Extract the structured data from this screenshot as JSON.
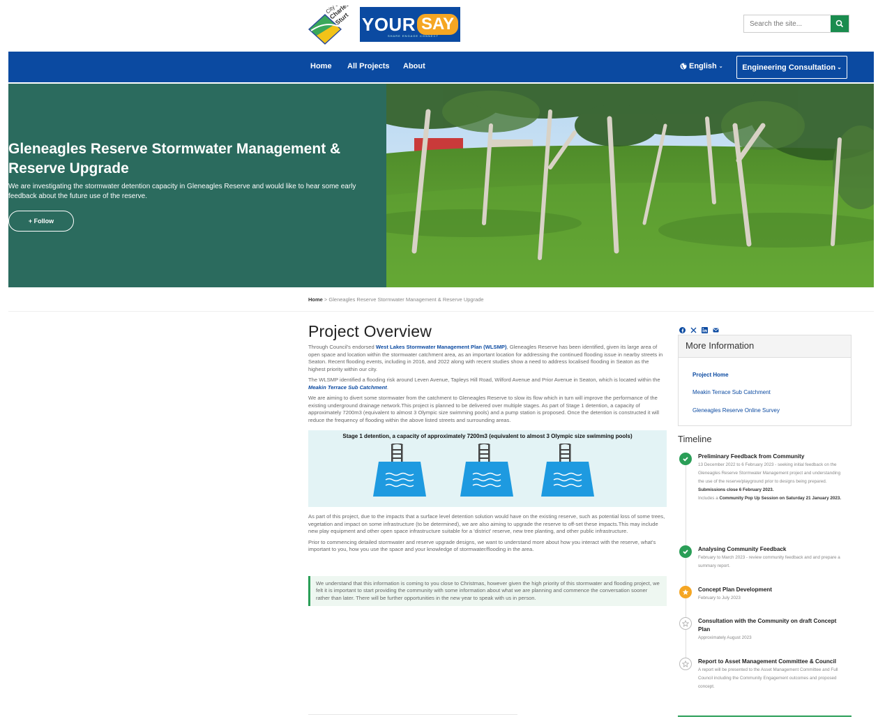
{
  "brand": {
    "city_logo_text": "City of Charles Sturt",
    "yoursay_your": "YOUR",
    "yoursay_say": "SAY",
    "yoursay_sub": "SHARE ENGAGE CONNECT"
  },
  "search": {
    "placeholder": "Search the site..."
  },
  "nav": {
    "items": [
      "Home",
      "All Projects",
      "About"
    ],
    "language": "English",
    "consultation": "Engineering Consultation"
  },
  "hero": {
    "title": "Gleneagles Reserve Stormwater Management & Reserve Upgrade",
    "description": "We are investigating the stormwater detention capacity in Gleneagles Reserve and would like to hear some early feedback about the future use of the reserve.",
    "follow_label": "+ Follow"
  },
  "breadcrumb": {
    "home": "Home",
    "sep": " > ",
    "current": "Gleneagles Reserve Stormwater Management & Reserve Upgrade"
  },
  "main": {
    "heading": "Project Overview",
    "p1_a": "Through Council's endorsed ",
    "p1_link": "West Lakes Stormwater Management Plan (WLSMP)",
    "p1_b": ", Gleneagles Reserve has been identified, given its large area of open space and location within the stormwater catchment area, as an important location for addressing the continued flooding issue in nearby streets in Seaton. Recent flooding events, including in 2016, and 2022 along with recent studies show a need to address localised flooding in Seaton as the highest priority within our city.",
    "p2_a": "The WLSMP identified a flooding risk around Leven Avenue, Tapleys Hill Road, Wilford Avenue and Prior Avenue in Seaton, which is located within the ",
    "p2_link": "Meakin Terrace Sub Catchment",
    "p2_b": ".",
    "p3": "We are aiming to divert some stormwater from the catchment to Gleneagles Reserve to slow its flow which in turn will improve the performance of the existing underground drainage network.This project is planned to be delivered over multiple stages. As part of Stage 1 detention, a capacity of approximately 7200m3 (equivalent to almost 3 Olympic size swimming pools) and a pump station is proposed. Once the detention is constructed it will reduce the frequency of flooding within the above listed streets and surrounding areas.",
    "stage_title": "Stage 1 detention, a capacity of approximately 7200m3 (equivalent to almost 3 Olympic size swimming pools)",
    "p4": "As part of this project, due to the impacts that a surface level detention solution would have on the existing reserve, such as potential loss of some trees, vegetation and impact on some infrastructure (to be determined), we are also aiming to upgrade the reserve to off-set these impacts.This may include new play equipment and other open space infrastructure suitable for a 'district' reserve, new tree planting, and other public infrastructure.",
    "p5": "Prior to commencing detailed stormwater and reserve upgrade designs, we want to understand more about how you interact with the reserve, what's important to you, how you use the space and your knowledge of stormwater/flooding in the area.",
    "notice": "We understand that this information is coming to you close to Christmas, however given the high priority of this stormwater and flooding project, we felt it is important to start providing the community with some information about what we are planning and commence the conversation sooner rather than later. There will be further opportunities in the new year to speak with us in person."
  },
  "sidebar": {
    "more_info_title": "More Information",
    "links": [
      "Project Home",
      "Meakin Terrace Sub Catchment",
      "Gleneagles Reserve Online Survey"
    ],
    "timeline_title": "Timeline",
    "timeline": [
      {
        "title": "Preliminary Feedback from Community",
        "status": "complete",
        "desc": "13 December 2022 to 6 February 2023 - seeking initial feedback on the Gleneagles Reserve Stormwater Management project and understanding the use of the reserve/playground prior to designs being prepared.",
        "extra1": "Submissions close 6 February 2023.",
        "extra2_a": "Includes a ",
        "extra2_b": "Community Pop Up Session on Saturday 21 January 2023."
      },
      {
        "title": "Analysing Community Feedback",
        "status": "complete",
        "desc": "February to March 2023 - review community feedback and and prepare a summary report."
      },
      {
        "title": "Concept Plan Development",
        "status": "active",
        "desc": "February to July 2023"
      },
      {
        "title": "Consultation with the Community on draft Concept Plan",
        "status": "upcoming",
        "desc": "Approximately August 2023"
      },
      {
        "title": "Report to Asset Management Committee & Council",
        "status": "upcoming",
        "desc": "A report will be presented to the Asset Management Committee and Full Council including the Community Engagement outcomes and proposed concept."
      }
    ]
  },
  "colors": {
    "nav": "#0b4aa1",
    "hero": "#2b6b5e",
    "success": "#2a9e57",
    "active": "#f5a623"
  },
  "icons": [
    "search-icon",
    "globe-icon",
    "facebook-icon",
    "x-icon",
    "linkedin-icon",
    "email-icon",
    "check-icon",
    "star-icon",
    "pool-ladder-icon"
  ]
}
